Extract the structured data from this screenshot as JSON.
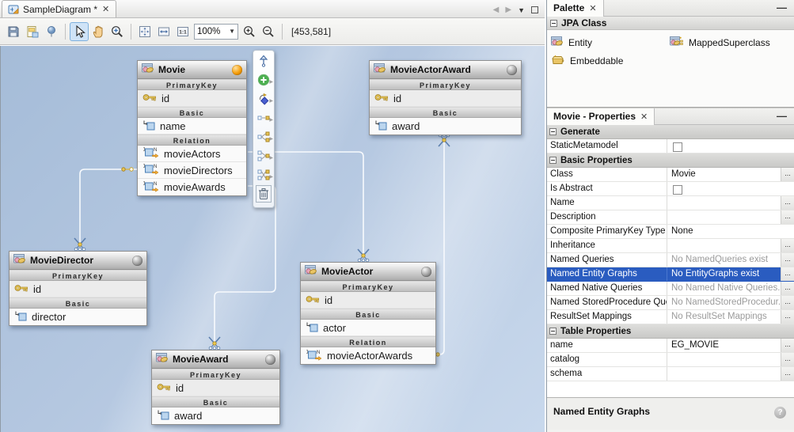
{
  "editor": {
    "tab_title": "SampleDiagram *",
    "zoom_level": "100%",
    "coordinates": "[453,581]",
    "toolbar_icons": [
      "save-icon",
      "export-image-icon",
      "lamp-icon",
      "select-tool-icon",
      "pan-tool-icon",
      "interactive-zoom-icon",
      "fit-diagram-icon",
      "fit-width-icon",
      "actual-size-icon",
      "zoom-in-icon",
      "zoom-out-icon"
    ],
    "actual_size_label": "1:1",
    "active_tool": "select"
  },
  "diagram": {
    "entities": [
      {
        "name": "Movie",
        "sphere": "orange",
        "sections": [
          {
            "label": "PrimaryKey",
            "attrs": [
              {
                "icon": "key-icon",
                "name": "id"
              }
            ]
          },
          {
            "label": "Basic",
            "attrs": [
              {
                "icon": "basic-attr-icon",
                "name": "name"
              }
            ]
          },
          {
            "label": "Relation",
            "attrs": [
              {
                "icon": "relation-attr-icon",
                "name": "movieActors"
              },
              {
                "icon": "relation-attr-icon",
                "name": "movieDirectors"
              },
              {
                "icon": "relation-attr-icon",
                "name": "movieAwards"
              }
            ]
          }
        ]
      },
      {
        "name": "MovieActorAward",
        "sphere": "silver",
        "sections": [
          {
            "label": "PrimaryKey",
            "attrs": [
              {
                "icon": "key-icon",
                "name": "id"
              }
            ]
          },
          {
            "label": "Basic",
            "attrs": [
              {
                "icon": "basic-attr-icon",
                "name": "award"
              }
            ]
          }
        ]
      },
      {
        "name": "MovieDirector",
        "sphere": "silver",
        "sections": [
          {
            "label": "PrimaryKey",
            "attrs": [
              {
                "icon": "key-icon",
                "name": "id"
              }
            ]
          },
          {
            "label": "Basic",
            "attrs": [
              {
                "icon": "basic-attr-icon",
                "name": "director"
              }
            ]
          }
        ]
      },
      {
        "name": "MovieActor",
        "sphere": "silver",
        "sections": [
          {
            "label": "PrimaryKey",
            "attrs": [
              {
                "icon": "key-icon",
                "name": "id"
              }
            ]
          },
          {
            "label": "Basic",
            "attrs": [
              {
                "icon": "basic-attr-icon",
                "name": "actor"
              }
            ]
          },
          {
            "label": "Relation",
            "attrs": [
              {
                "icon": "relation-attr-icon",
                "name": "movieActorAwards"
              }
            ]
          }
        ]
      },
      {
        "name": "MovieAward",
        "sphere": "silver",
        "sections": [
          {
            "label": "PrimaryKey",
            "attrs": [
              {
                "icon": "key-icon",
                "name": "id"
              }
            ]
          },
          {
            "label": "Basic",
            "attrs": [
              {
                "icon": "basic-attr-icon",
                "name": "award"
              }
            ]
          }
        ]
      }
    ],
    "widget_toolbar": [
      {
        "icon": "pin-icon",
        "caret": false
      },
      {
        "icon": "add-attribute-icon",
        "caret": true
      },
      {
        "icon": "link-icon",
        "caret": true
      },
      {
        "icon": "one-to-one-icon",
        "caret": true
      },
      {
        "icon": "one-to-many-icon",
        "caret": true
      },
      {
        "icon": "many-to-one-icon",
        "caret": true
      },
      {
        "icon": "many-to-many-icon",
        "caret": true
      },
      {
        "icon": "delete-icon",
        "caret": false
      }
    ],
    "relations": [
      "Movie.movieDirectors -> MovieDirector",
      "Movie.movieActors -> MovieActor",
      "Movie.movieAwards -> MovieAward",
      "MovieActor.movieActorAwards -> MovieActorAward"
    ]
  },
  "palette": {
    "tab_title": "Palette",
    "group_title": "JPA Class",
    "items": [
      {
        "icon": "entity-icon",
        "label": "Entity"
      },
      {
        "icon": "mapped-superclass-icon",
        "label": "MappedSuperclass"
      },
      {
        "icon": "embeddable-icon",
        "label": "Embeddable"
      }
    ]
  },
  "properties": {
    "tab_title": "Movie - Properties",
    "rows": [
      {
        "type": "section",
        "label": "Generate"
      },
      {
        "type": "row",
        "label": "StaticMetamodel",
        "editor": "checkbox"
      },
      {
        "type": "section",
        "label": "Basic Properties"
      },
      {
        "type": "row",
        "label": "Class",
        "value": "Movie",
        "button": true
      },
      {
        "type": "row",
        "label": "Is Abstract",
        "editor": "checkbox"
      },
      {
        "type": "row",
        "label": "Name",
        "value": "",
        "button": true
      },
      {
        "type": "row",
        "label": "Description",
        "value": "",
        "button": true
      },
      {
        "type": "row",
        "label": "Composite PrimaryKey Type",
        "value": "None",
        "button": false
      },
      {
        "type": "row",
        "label": "Inheritance",
        "value": "",
        "button": true
      },
      {
        "type": "row",
        "label": "Named Queries",
        "value": "No NamedQueries exist",
        "placeholder": true,
        "button": true
      },
      {
        "type": "row",
        "label": "Named Entity Graphs",
        "value": "No EntityGraphs exist",
        "selected": true,
        "button": true
      },
      {
        "type": "row",
        "label": "Named Native Queries",
        "value": "No Named Native Queries...",
        "placeholder": true,
        "button": true
      },
      {
        "type": "row",
        "label": "Named StoredProcedure Querie",
        "value": "No NamedStoredProcedur...",
        "placeholder": true,
        "button": true
      },
      {
        "type": "row",
        "label": "ResultSet Mappings",
        "value": "No ResultSet Mappings",
        "placeholder": true,
        "button": true
      },
      {
        "type": "section",
        "label": "Table Properties"
      },
      {
        "type": "row",
        "label": "name",
        "value": "EG_MOVIE",
        "button": true
      },
      {
        "type": "row",
        "label": "catalog",
        "value": "",
        "button": true
      },
      {
        "type": "row",
        "label": "schema",
        "value": "",
        "button": true
      }
    ],
    "description_title": "Named Entity Graphs"
  }
}
